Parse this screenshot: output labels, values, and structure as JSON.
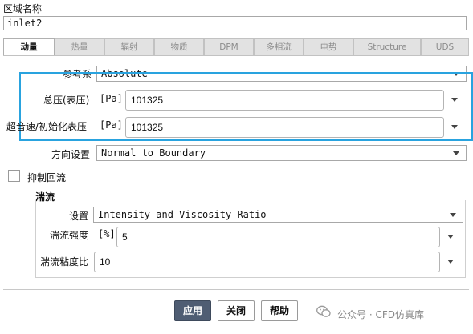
{
  "zone": {
    "label": "区域名称",
    "value": "inlet2"
  },
  "tabs": [
    {
      "label": "动量",
      "active": true
    },
    {
      "label": "热量",
      "active": false
    },
    {
      "label": "辐射",
      "active": false
    },
    {
      "label": "物质",
      "active": false
    },
    {
      "label": "DPM",
      "active": false
    },
    {
      "label": "多相流",
      "active": false
    },
    {
      "label": "电势",
      "active": false
    },
    {
      "label": "Structure",
      "active": false
    },
    {
      "label": "UDS",
      "active": false
    }
  ],
  "momentum": {
    "reference_frame": {
      "label": "参考系",
      "value": "Absolute"
    },
    "gauge_total_pressure": {
      "label": "总压(表压)",
      "unit": "[Pa]",
      "value": "101325"
    },
    "supersonic_pressure": {
      "label": "超音速/初始化表压",
      "unit": "[Pa]",
      "value": "101325"
    },
    "direction": {
      "label": "方向设置",
      "value": "Normal to Boundary"
    },
    "prevent_backflow": {
      "label": "抑制回流",
      "checked": false
    }
  },
  "turbulence": {
    "title": "湍流",
    "spec": {
      "label": "设置",
      "value": "Intensity and Viscosity Ratio"
    },
    "intensity": {
      "label": "湍流强度",
      "unit": "[%]",
      "value": "5"
    },
    "viscosity_ratio": {
      "label": "湍流粘度比",
      "value": "10"
    }
  },
  "buttons": {
    "apply": "应用",
    "close": "关闭",
    "help": "帮助"
  },
  "watermark": "公众号 · CFD仿真库",
  "colors": {
    "highlight_border": "#29a3df",
    "apply_button": "#4f5d73"
  }
}
